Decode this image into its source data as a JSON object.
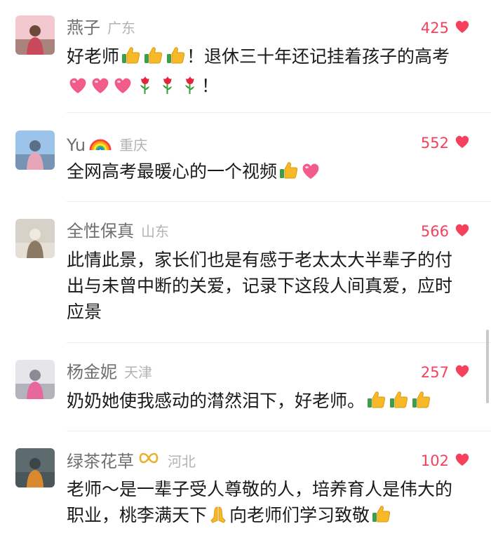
{
  "comments": [
    {
      "name": "燕子",
      "region": "广东",
      "likes": "425",
      "avatar": "photo-avatar",
      "text": [
        {
          "t": "好老师"
        },
        {
          "e": "thumbs-up-icon"
        },
        {
          "e": "thumbs-up-icon"
        },
        {
          "e": "thumbs-up-icon"
        },
        {
          "t": "！退休三十年还记挂着孩子的高考"
        },
        {
          "e": "heart-emoji-icon"
        },
        {
          "e": "heart-emoji-icon"
        },
        {
          "e": "heart-emoji-icon"
        },
        {
          "e": "rose-icon"
        },
        {
          "e": "rose-icon"
        },
        {
          "e": "rose-icon"
        },
        {
          "t": "！"
        }
      ]
    },
    {
      "name": "Yu",
      "region": "重庆",
      "likes": "552",
      "avatar": "photo-avatar",
      "badge": "rainbow-icon",
      "text": [
        {
          "t": "全网高考最暖心的一个视频"
        },
        {
          "e": "thumbs-up-icon"
        },
        {
          "e": "heart-emoji-icon"
        }
      ]
    },
    {
      "name": "全性保真",
      "region": "山东",
      "likes": "566",
      "avatar": "photo-avatar",
      "text": [
        {
          "t": "此情此景，家长们也是有感于老太太大半辈子的付出与未曾中断的关爱，记录下这段人间真爱，应时应景"
        }
      ]
    },
    {
      "name": "杨金妮",
      "region": "天津",
      "likes": "257",
      "avatar": "photo-avatar",
      "text": [
        {
          "t": "奶奶她使我感动的潸然泪下，好老师。"
        },
        {
          "e": "thumbs-up-icon"
        },
        {
          "e": "thumbs-up-icon"
        },
        {
          "e": "thumbs-up-icon"
        }
      ]
    },
    {
      "name": "绿茶花草",
      "region": "河北",
      "likes": "102",
      "avatar": "photo-avatar",
      "badge": "infinity-icon",
      "text": [
        {
          "t": "老师～是一辈子受人尊敬的人，培养育人是伟大的职业，桃李满天下"
        },
        {
          "e": "pray-icon"
        },
        {
          "t": "向老师们学习致敬"
        },
        {
          "e": "thumbs-up-icon"
        }
      ]
    }
  ],
  "colors": {
    "accent": "#f5415b",
    "name": "#6f6f6f",
    "region": "#b3b3b3",
    "text": "#1a1a1a"
  }
}
